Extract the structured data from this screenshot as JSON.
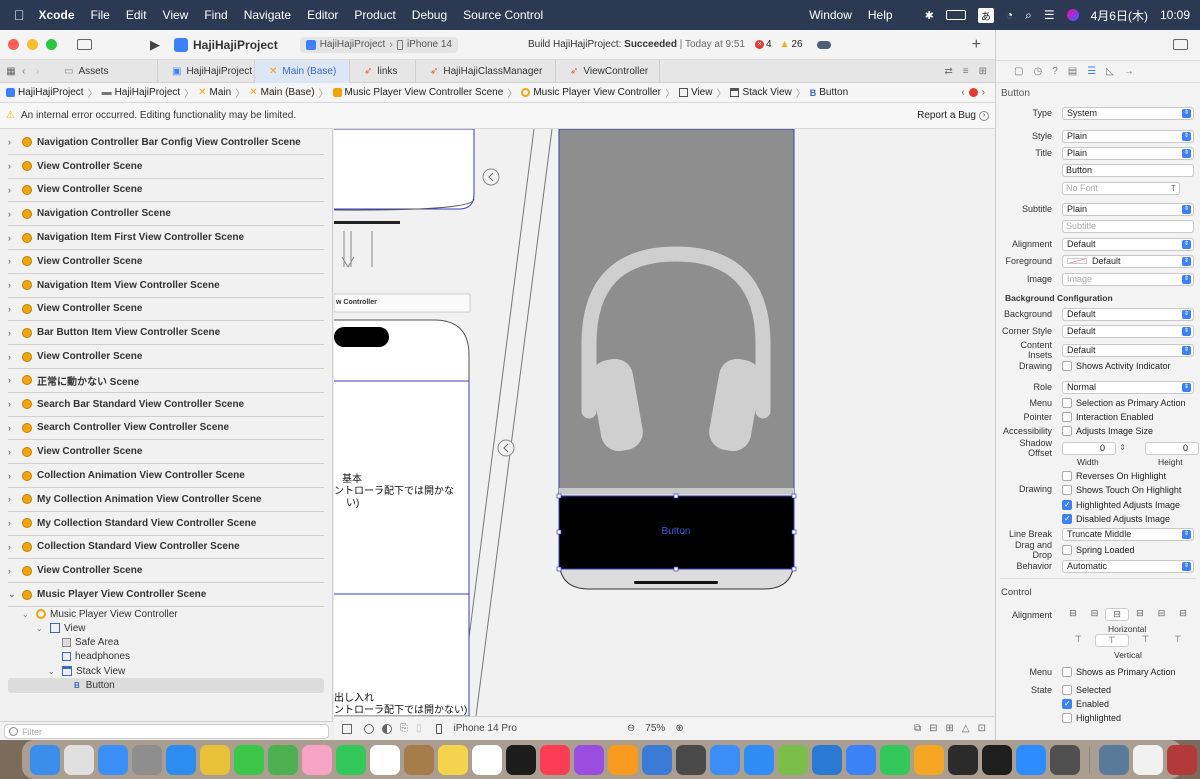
{
  "menubar": {
    "app": "Xcode",
    "items": [
      "File",
      "Edit",
      "View",
      "Find",
      "Navigate",
      "Editor",
      "Product",
      "Debug",
      "Source Control"
    ],
    "window": "Window",
    "help": "Help",
    "input": "あ",
    "datetime": "4月6日(木)",
    "time": "10:09"
  },
  "toolbar": {
    "project": "HajiHajiProject",
    "scheme": "HajiHajiProject",
    "device": "iPhone 14",
    "status_prefix": "Build HajiHajiProject: ",
    "status_result": "Succeeded",
    "status_time": "| Today at 9:51",
    "errors": "4",
    "warnings": "26",
    "add": "+"
  },
  "tabs": [
    "Assets",
    "HajiHajiProject",
    "Main (Base)",
    "links",
    "HajiHajiClassManager",
    "ViewController"
  ],
  "jump": [
    "HajiHajiProject",
    "HajiHajiProject",
    "Main",
    "Main (Base)",
    "Music Player View Controller Scene",
    "Music Player View Controller",
    "View",
    "Stack View",
    "Button"
  ],
  "warning": {
    "text": "An internal error occurred. Editing functionality may be limited.",
    "report": "Report a Bug"
  },
  "outline": {
    "scenes": [
      "Navigation Controller Bar Config View Controller Scene",
      "View Controller Scene",
      "View Controller Scene",
      "Navigation Controller Scene",
      "Navigation Item First View Controller Scene",
      "View Controller Scene",
      "Navigation Item View Controller Scene",
      "View Controller Scene",
      "Bar Button Item View Controller Scene",
      "View Controller Scene",
      "正常に動かない Scene",
      "Search Bar Standard View Controller Scene",
      "Search Controller View Controller Scene",
      "View Controller Scene",
      "Collection Animation View Controller Scene",
      "My Collection Animation View Controller Scene",
      "My Collection Standard View Controller Scene",
      "Collection Standard View Controller Scene",
      "View Controller Scene",
      "Music Player View Controller Scene"
    ],
    "tree": [
      "Music Player View Controller",
      "View",
      "Safe Area",
      "headphones",
      "Stack View",
      "Button"
    ],
    "filter_placeholder": "Filter"
  },
  "canvas": {
    "vc_label": "w Controller",
    "text1_a": "基本",
    "text1_b": "ントローラ配下では開かな",
    "text1_c": "い)",
    "text2_a": "出し入れ",
    "text2_b": "ントローラ配下では開かない)",
    "button": "Button",
    "device": "iPhone 14 Pro",
    "zoom": "75%"
  },
  "inspector": {
    "header": "Button",
    "type": {
      "label": "Type",
      "value": "System"
    },
    "style": {
      "label": "Style",
      "value": "Plain"
    },
    "title": {
      "label": "Title",
      "value": "Plain"
    },
    "title_text": "Button",
    "font_placeholder": "No Font",
    "subtitle": {
      "label": "Subtitle",
      "value": "Plain"
    },
    "subtitle_placeholder": "Subtitle",
    "alignment": {
      "label": "Alignment",
      "value": "Default"
    },
    "foreground": {
      "label": "Foreground",
      "value": "Default"
    },
    "image": {
      "label": "Image",
      "placeholder": "Image"
    },
    "bg_config": "Background Configuration",
    "background": {
      "label": "Background",
      "value": "Default"
    },
    "corner": {
      "label": "Corner Style",
      "value": "Default"
    },
    "insets": {
      "label": "Content Insets",
      "value": "Default"
    },
    "drawing1": {
      "label": "Drawing",
      "check": "Shows Activity Indicator"
    },
    "role": {
      "label": "Role",
      "value": "Normal"
    },
    "menu": {
      "label": "Menu",
      "check": "Selection as Primary Action"
    },
    "pointer": {
      "label": "Pointer",
      "check": "Interaction Enabled"
    },
    "accessibility": {
      "label": "Accessibility",
      "check": "Adjusts Image Size"
    },
    "shadow": {
      "label": "Shadow Offset",
      "w": "0",
      "h": "0",
      "wl": "Width",
      "hl": "Height"
    },
    "drawing2": {
      "label": "Drawing",
      "checks": [
        "Reverses On Highlight",
        "Shows Touch On Highlight",
        "Highlighted Adjusts Image",
        "Disabled Adjusts Image"
      ]
    },
    "linebreak": {
      "label": "Line Break",
      "value": "Truncate Middle"
    },
    "dragdrop": {
      "label": "Drag and Drop",
      "check": "Spring Loaded"
    },
    "behavior": {
      "label": "Behavior",
      "value": "Automatic"
    },
    "control": "Control",
    "calign": {
      "label": "Alignment",
      "h": "Horizontal",
      "v": "Vertical"
    },
    "cmenu": {
      "label": "Menu",
      "check": "Shows as Primary Action"
    },
    "state": {
      "label": "State",
      "checks": [
        "Selected",
        "Enabled",
        "Highlighted"
      ]
    }
  },
  "colors": {
    "accent": "#3c82f6",
    "menubar": "#2b3a52",
    "scene_icon": "#f0a510",
    "button_text": "#3b5bdb",
    "headphones": "#cfcfcf",
    "panel_gray": "#8e8e8e"
  }
}
